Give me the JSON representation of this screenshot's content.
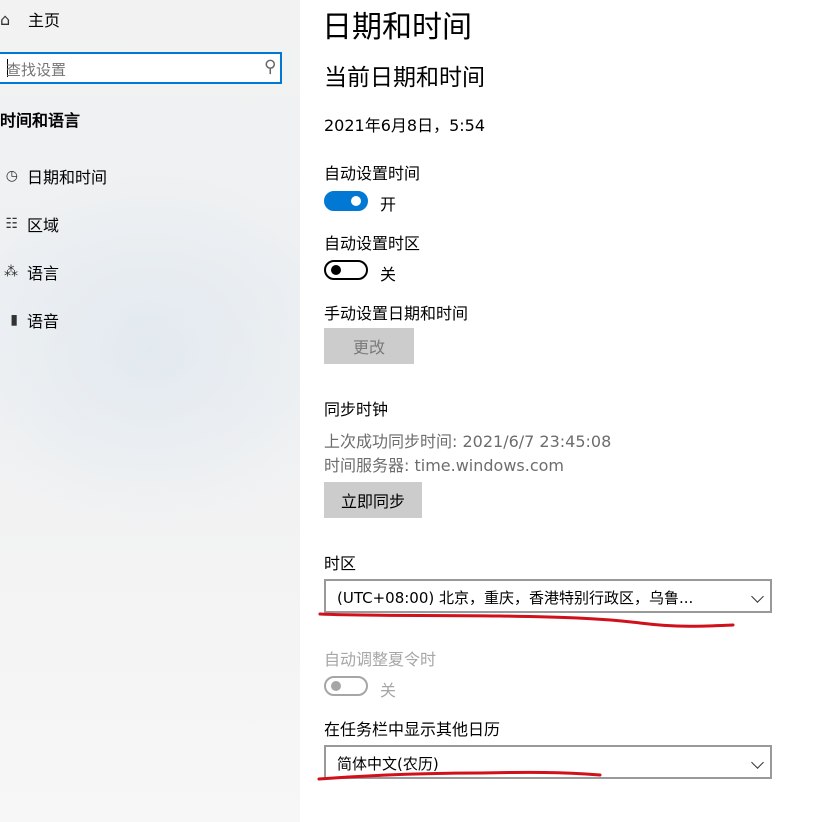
{
  "sidebar": {
    "home_icon": "home-icon",
    "home_label": "主页",
    "search_placeholder": "查找设置",
    "search_icon": "search-icon",
    "section_title": "时间和语言",
    "items": [
      {
        "label": "日期和时间",
        "icon": "clock-icon"
      },
      {
        "label": "区域",
        "icon": "globe-icon"
      },
      {
        "label": "语言",
        "icon": "language-icon"
      },
      {
        "label": "语音",
        "icon": "microphone-icon"
      }
    ]
  },
  "main": {
    "page_title": "日期和时间",
    "current_section_title": "当前日期和时间",
    "current_datetime": "2021年6月8日，5:54",
    "auto_time": {
      "label": "自动设置时间",
      "state_label": "开",
      "on": true
    },
    "auto_timezone": {
      "label": "自动设置时区",
      "state_label": "关",
      "on": false
    },
    "manual": {
      "label": "手动设置日期和时间",
      "button_label": "更改"
    },
    "sync": {
      "title": "同步时钟",
      "last_sync": "上次成功同步时间: 2021/6/7 23:45:08",
      "time_server": "时间服务器: time.windows.com",
      "button_label": "立即同步"
    },
    "timezone": {
      "label": "时区",
      "value": "(UTC+08:00) 北京，重庆，香港特别行政区，乌鲁..."
    },
    "dst": {
      "label": "自动调整夏令时",
      "state_label": "关",
      "on": false,
      "enabled": false
    },
    "calendar": {
      "label": "在任务栏中显示其他日历",
      "value": "简体中文(农历)"
    }
  },
  "colors": {
    "accent": "#0078d4",
    "annotation": "#d0101a",
    "disabled_text": "#a6a6a6"
  }
}
